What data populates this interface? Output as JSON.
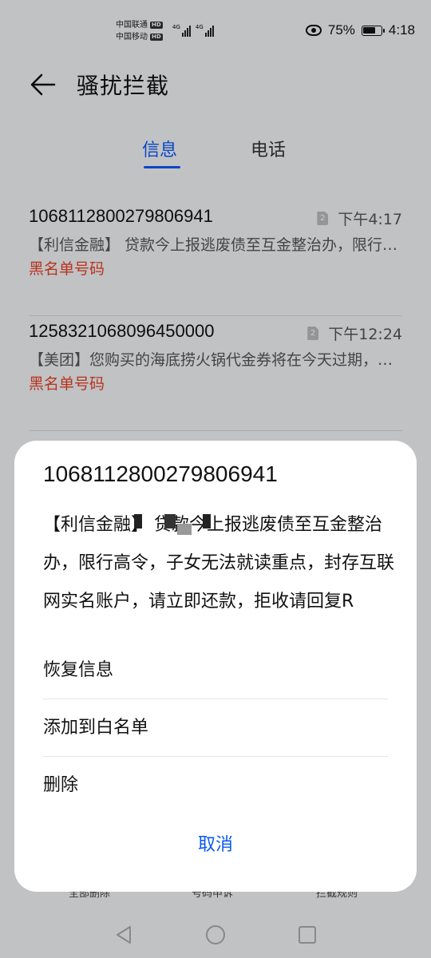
{
  "status_bar": {
    "carrier1": "中国联通",
    "carrier2": "中国移动",
    "hd": "HD",
    "network": "4G",
    "battery": "75%",
    "battery_level": 0.75,
    "time": "4:18"
  },
  "header": {
    "title": "骚扰拦截"
  },
  "tabs": [
    {
      "label": "信息"
    },
    {
      "label": "电话"
    }
  ],
  "messages": [
    {
      "number": "1068112800279806941",
      "sim": "2",
      "time": "下午4:17",
      "preview": "【利信金融】 贷款今上报逃废债至互金整治办，限行高令",
      "tag": "黑名单号码"
    },
    {
      "number": "1258321068096450000",
      "sim": "2",
      "time": "下午12:24",
      "preview": "【美团】您购买的海底捞火锅代金券将在今天过期，请尽快使用",
      "tag": "黑名单号码"
    }
  ],
  "bottom_actions": {
    "delete_all": "全部删除",
    "appeal": "号码申诉",
    "rules": "拦截规则"
  },
  "dialog": {
    "title": "1068112800279806941",
    "body": "【利信金融】 贷款今上报逃废债至互金整治办，限行高令，子女无法就读重点，封存互联网实名账户，请立即还款，拒收请回复R",
    "actions": [
      {
        "label": "恢复信息"
      },
      {
        "label": "添加到白名单"
      },
      {
        "label": "删除"
      }
    ],
    "cancel": "取消"
  },
  "colors": {
    "accent": "#0a59f7",
    "blacklist_tag": "#e84026"
  }
}
